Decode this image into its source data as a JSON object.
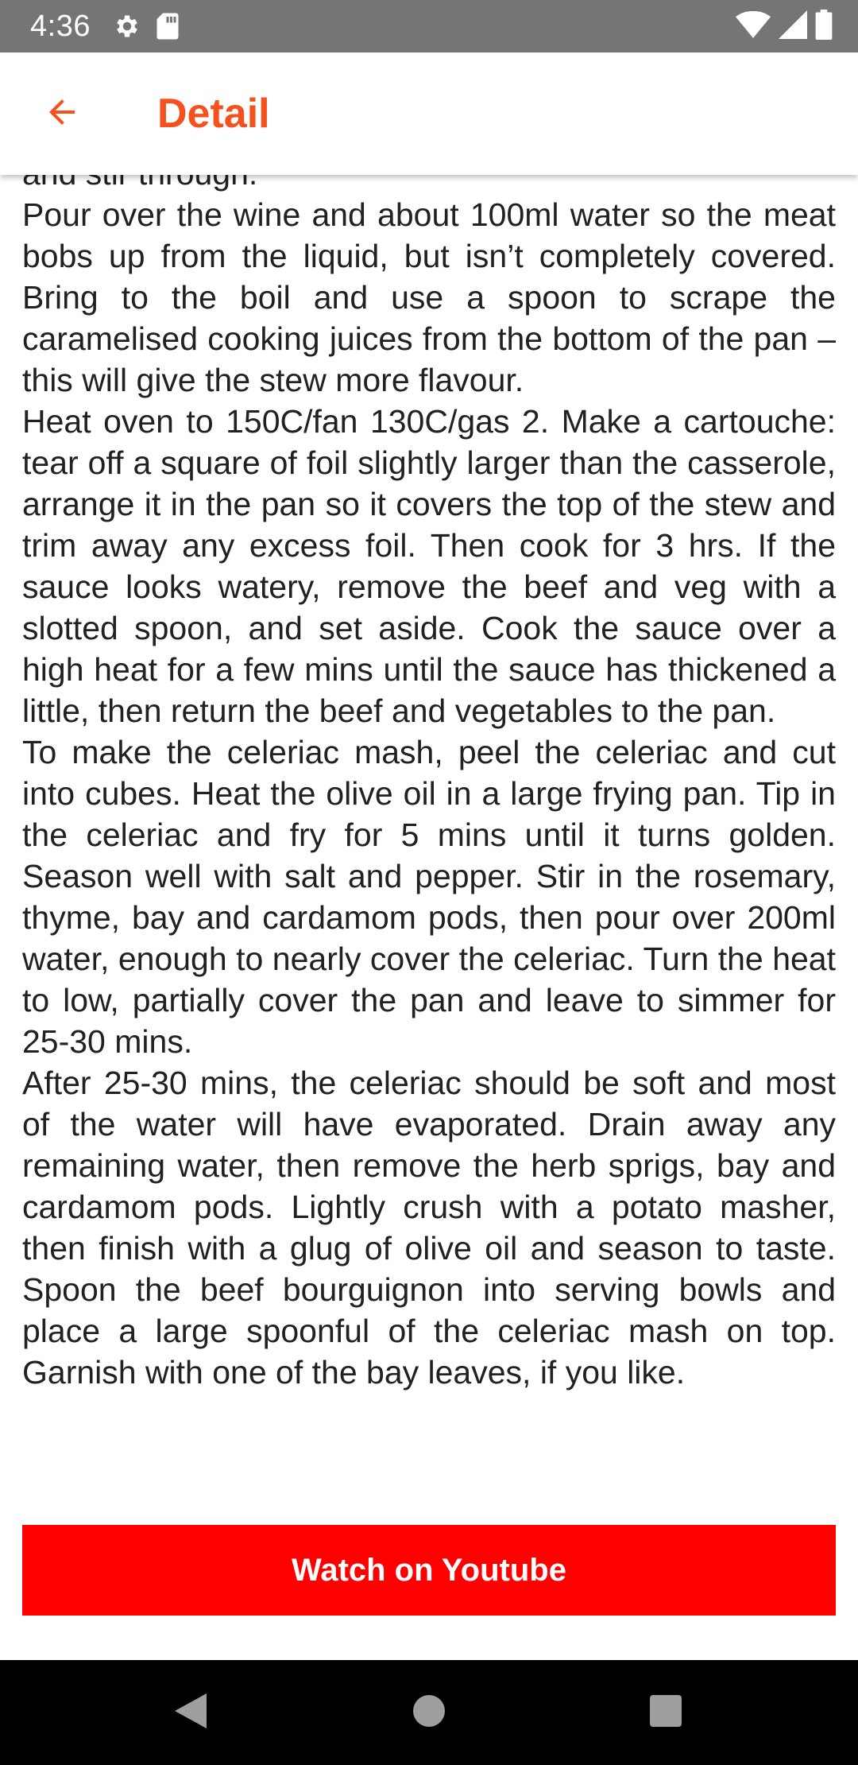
{
  "status_bar": {
    "time": "4:36",
    "icons": [
      "gear-icon",
      "sd-card-icon",
      "wifi-icon",
      "signal-icon",
      "battery-icon"
    ]
  },
  "app_bar": {
    "back_icon": "arrow-back-icon",
    "title": "Detail",
    "accent_color": "#F4511E"
  },
  "recipe": {
    "instructions": "and stir through.\nPour over the wine and about 100ml water so the meat bobs up from the liquid, but isn’t completely covered. Bring to the boil and use a spoon to scrape the caramelised cooking juices from the bottom of the pan – this will give the stew more flavour.\nHeat oven to 150C/fan 130C/gas 2. Make a cartouche: tear off a square of foil slightly larger than the casserole, arrange it in the pan so it covers the top of the stew and trim away any excess foil. Then cook for 3 hrs. If the sauce looks watery, remove the beef and veg with a slotted spoon, and set aside. Cook the sauce over a high heat for a few mins until the sauce has thickened a little, then return the beef and vegetables to the pan.\nTo make the celeriac mash, peel the celeriac and cut into cubes. Heat the olive oil in a large frying pan. Tip in the celeriac and fry for 5 mins until it turns golden. Season well with salt and pepper. Stir in the rosemary, thyme, bay and cardamom pods, then pour over 200ml water, enough to nearly cover the celeriac. Turn the heat to low, partially cover the pan and leave to simmer for 25-30 mins.\nAfter 25-30 mins, the celeriac should be soft and most of the water will have evaporated. Drain away any remaining water, then remove the herb sprigs, bay and cardamom pods. Lightly crush with a potato masher, then finish with a glug of olive oil and season to taste. Spoon the beef bourguignon into serving bowls and place a large spoonful of the celeriac mash on top. Garnish with one of the bay leaves, if you like.",
    "watch_button_label": "Watch on Youtube",
    "watch_button_color": "#FF0000"
  },
  "nav_bar": {
    "buttons": [
      "back-triangle-icon",
      "home-circle-icon",
      "recents-square-icon"
    ]
  }
}
